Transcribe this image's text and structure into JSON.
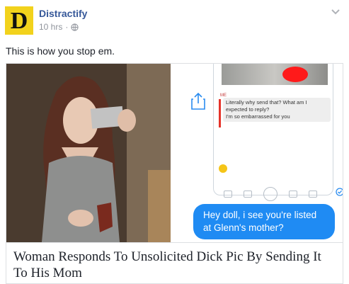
{
  "header": {
    "page_name": "Distractify",
    "logo_letter": "D",
    "time": "10 hrs",
    "separator": "·"
  },
  "post": {
    "text": "This is how you stop em."
  },
  "card": {
    "headline": "Woman Responds To Unsolicited Dick Pic By Sending It To His Mom",
    "chat": {
      "me_label": "ME",
      "gray_message": "Literally why send that? What am I expected to reply?",
      "gray_message_2": "I'm so embarrassed for you",
      "blue_message": "Hey doll, i see you're listed at Glenn's mother?"
    }
  },
  "colors": {
    "brand_yellow": "#f2d21c",
    "link_blue": "#365899",
    "meta_gray": "#90949c",
    "bubble_blue": "#1f8bf3",
    "censor_red": "#ff1a1a"
  },
  "icons": [
    "globe-icon",
    "chevron-down-icon",
    "share-icon",
    "check-icon"
  ]
}
